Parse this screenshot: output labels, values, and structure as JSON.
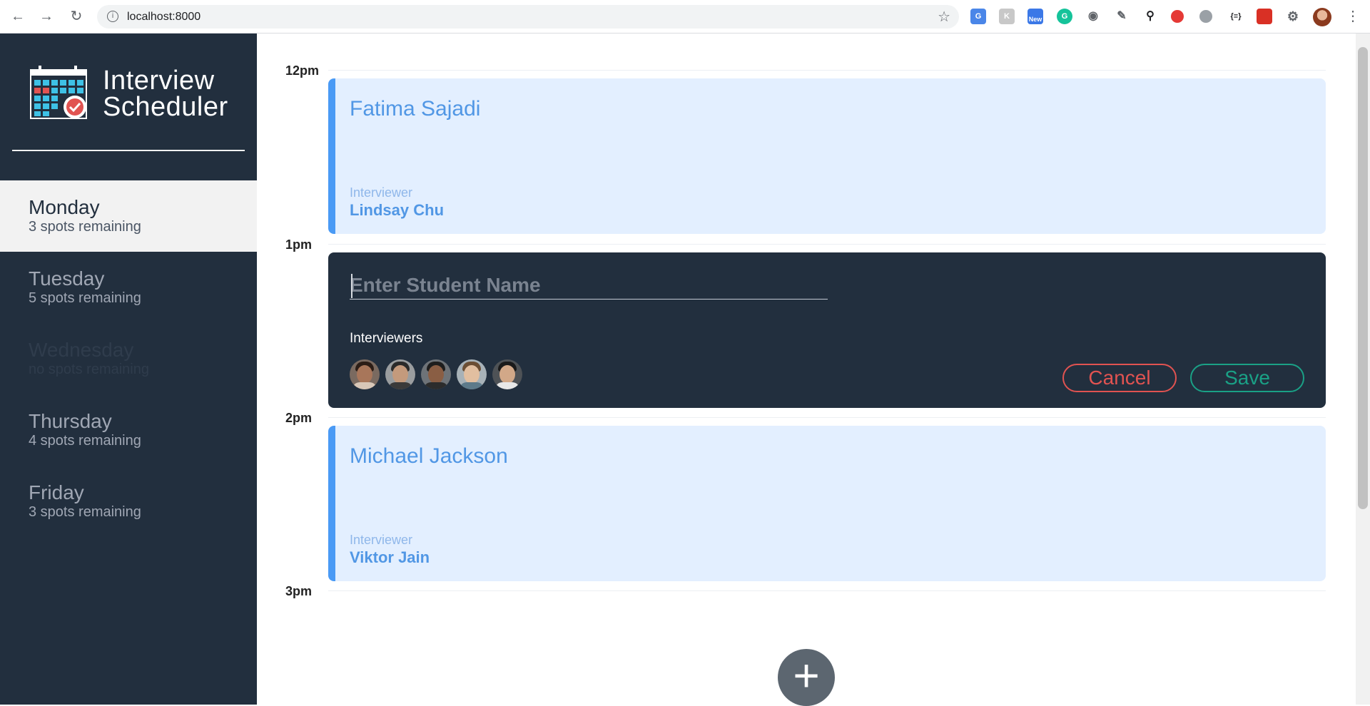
{
  "browser": {
    "url": "localhost:8000",
    "new_badge": "New"
  },
  "app": {
    "title_line1": "Interview",
    "title_line2": "Scheduler"
  },
  "days": [
    {
      "name": "Monday",
      "spots": "3 spots remaining"
    },
    {
      "name": "Tuesday",
      "spots": "5 spots remaining"
    },
    {
      "name": "Wednesday",
      "spots": "no spots remaining"
    },
    {
      "name": "Thursday",
      "spots": "4 spots remaining"
    },
    {
      "name": "Friday",
      "spots": "3 spots remaining"
    }
  ],
  "hours": [
    "12pm",
    "1pm",
    "2pm",
    "3pm"
  ],
  "appointments": {
    "first": {
      "student": "Fatima Sajadi",
      "interviewer_label": "Interviewer",
      "interviewer": "Lindsay Chu"
    },
    "form": {
      "placeholder": "Enter Student Name",
      "interviewers_label": "Interviewers",
      "cancel_label": "Cancel",
      "save_label": "Save"
    },
    "third": {
      "student": "Michael Jackson",
      "interviewer_label": "Interviewer",
      "interviewer": "Viktor Jain"
    }
  },
  "add_label": "+",
  "colors": {
    "sidebar": "#222f3e",
    "accent_blue": "#4a9af5",
    "cancel": "#e15351",
    "save": "#1aa186"
  }
}
